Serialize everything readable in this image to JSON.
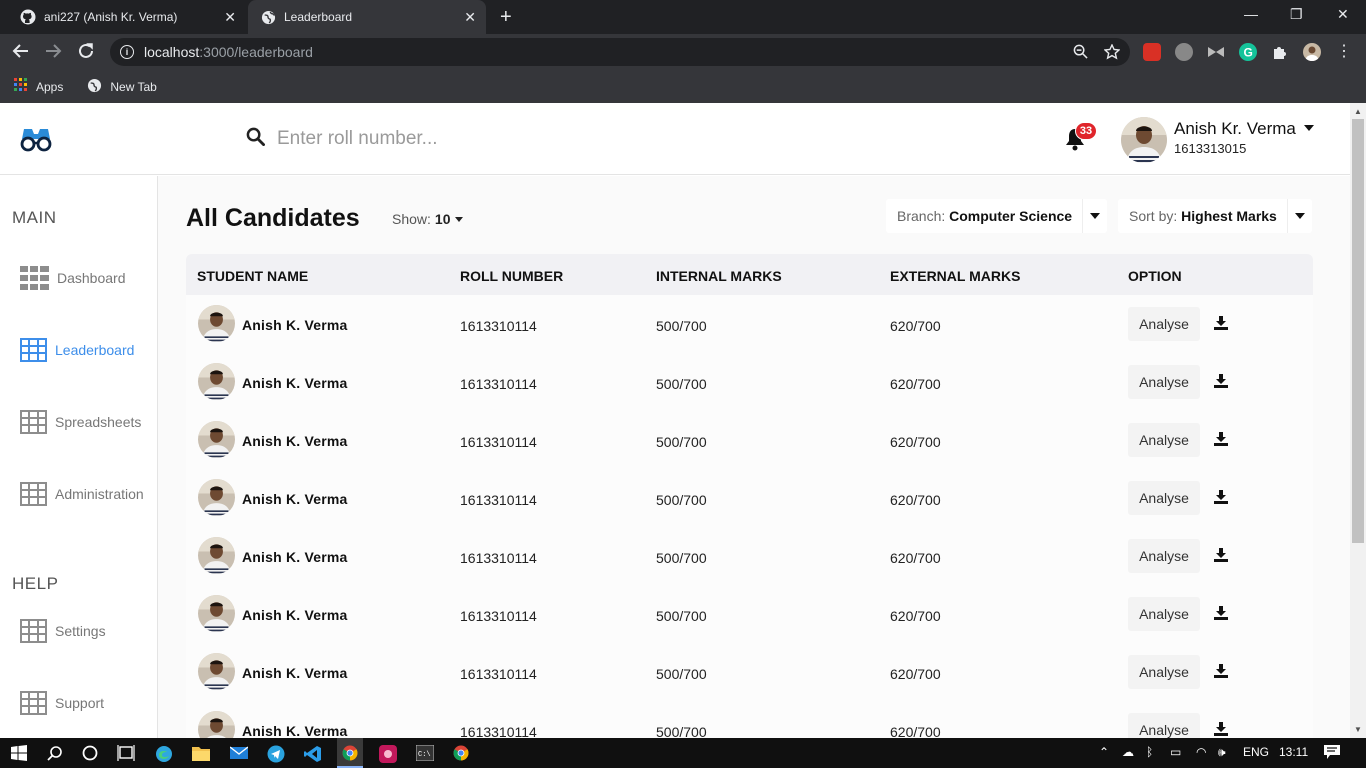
{
  "browser": {
    "tabs": [
      {
        "title": "ani227 (Anish Kr. Verma)"
      },
      {
        "title": "Leaderboard"
      }
    ],
    "url_host": "localhost",
    "url_path": ":3000/leaderboard",
    "bookmarks": [
      {
        "label": "Apps"
      },
      {
        "label": "New Tab"
      }
    ]
  },
  "header": {
    "search_placeholder": "Enter roll number...",
    "notification_count": "33",
    "user_name": "Anish Kr. Verma",
    "user_id": "1613313015"
  },
  "sidebar": {
    "main_heading": "MAIN",
    "help_heading": "HELP",
    "items": [
      {
        "label": "Dashboard"
      },
      {
        "label": "Leaderboard"
      },
      {
        "label": "Spreadsheets"
      },
      {
        "label": "Administration"
      },
      {
        "label": "Settings"
      },
      {
        "label": "Support"
      }
    ]
  },
  "main": {
    "title": "All Candidates",
    "show_label": "Show:",
    "show_value": "10",
    "branch_label": "Branch:",
    "branch_value": "Computer Science",
    "sort_label": "Sort by:",
    "sort_value": "Highest Marks",
    "columns": [
      "STUDENT NAME",
      "ROLL NUMBER",
      "INTERNAL MARKS",
      "EXTERNAL MARKS",
      "OPTION"
    ],
    "analyse_label": "Analyse",
    "rows": [
      {
        "name": "Anish K. Verma",
        "roll": "1613310114",
        "internal": "500/700",
        "external": "620/700"
      },
      {
        "name": "Anish K. Verma",
        "roll": "1613310114",
        "internal": "500/700",
        "external": "620/700"
      },
      {
        "name": "Anish K. Verma",
        "roll": "1613310114",
        "internal": "500/700",
        "external": "620/700"
      },
      {
        "name": "Anish K. Verma",
        "roll": "1613310114",
        "internal": "500/700",
        "external": "620/700"
      },
      {
        "name": "Anish K. Verma",
        "roll": "1613310114",
        "internal": "500/700",
        "external": "620/700"
      },
      {
        "name": "Anish K. Verma",
        "roll": "1613310114",
        "internal": "500/700",
        "external": "620/700"
      },
      {
        "name": "Anish K. Verma",
        "roll": "1613310114",
        "internal": "500/700",
        "external": "620/700"
      },
      {
        "name": "Anish K. Verma",
        "roll": "1613310114",
        "internal": "500/700",
        "external": "620/700"
      }
    ]
  },
  "taskbar": {
    "language": "ENG",
    "time": "13:11"
  },
  "colors": {
    "accent": "#3d8eea",
    "badge": "#e0252b"
  }
}
